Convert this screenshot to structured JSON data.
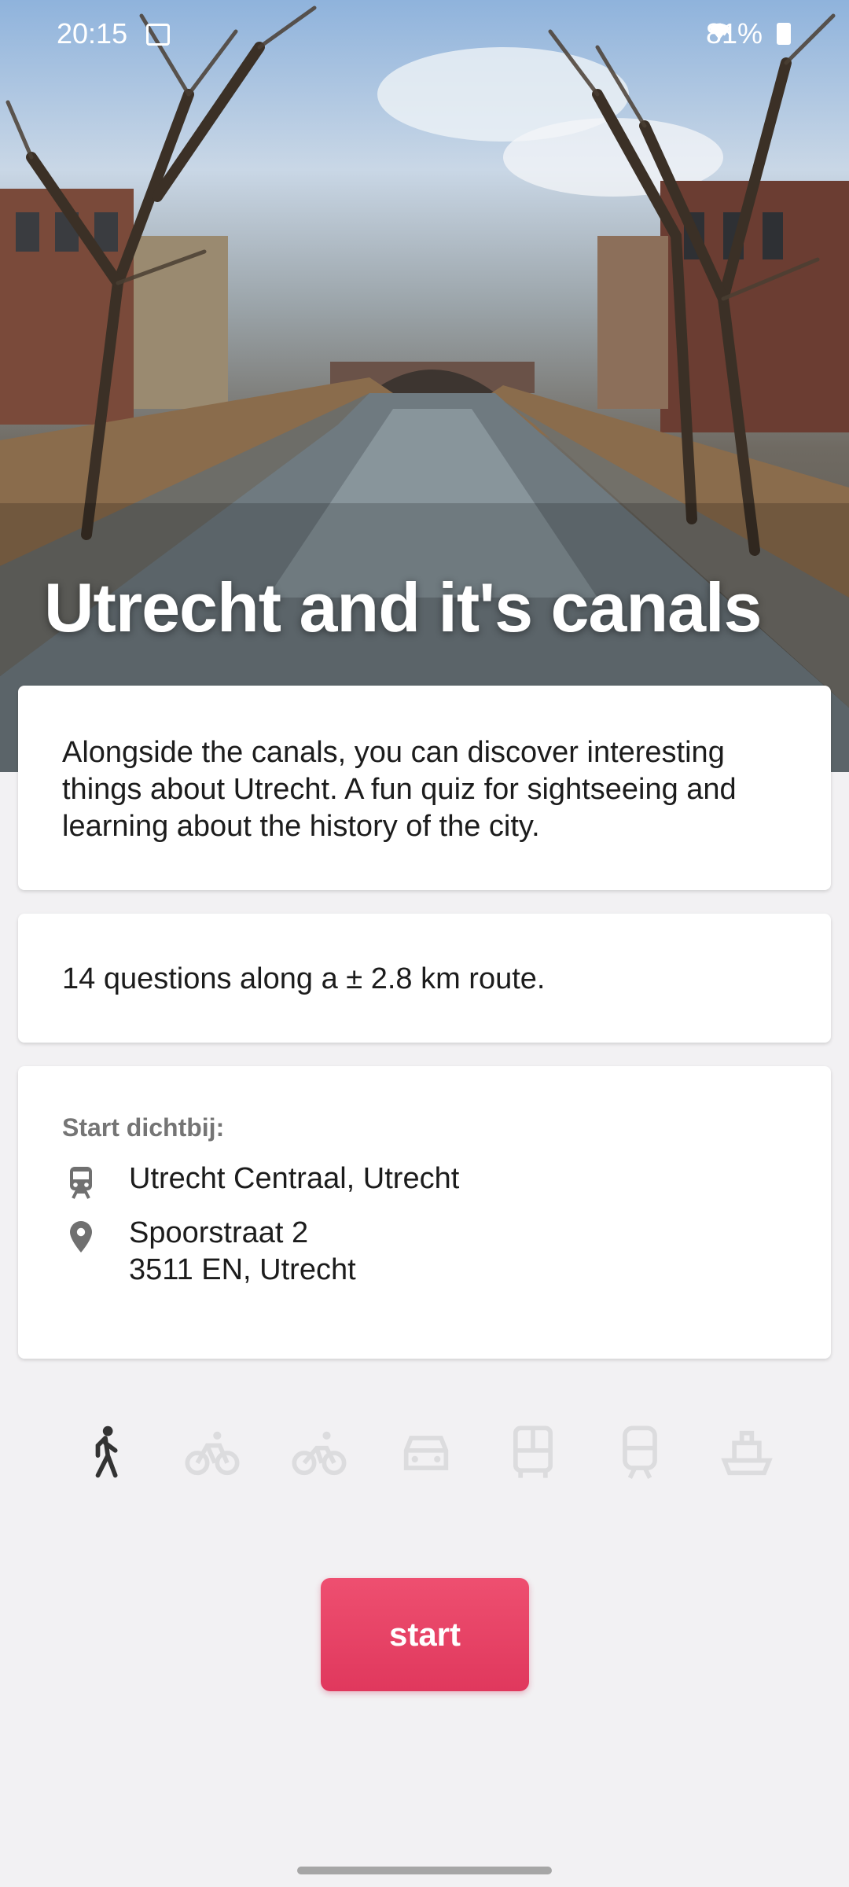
{
  "status_bar": {
    "time": "20:15",
    "battery": "81%",
    "icons": [
      "image-icon",
      "mute-icon",
      "wifi-icon",
      "battery-icon"
    ]
  },
  "hero": {
    "title": "Utrecht and it's canals"
  },
  "description": {
    "text": "Alongside the canals, you can discover interesting things about Utrecht. A fun quiz for sightseeing and learning about the history of the city."
  },
  "route": {
    "text": "14 questions along a ± 2.8 km route."
  },
  "start_location": {
    "label": "Start dichtbij:",
    "station": "Utrecht Centraal, Utrecht",
    "address_line1": "Spoorstraat 2",
    "address_line2": "3511 EN, Utrecht"
  },
  "transport_modes": [
    {
      "icon": "walk-icon",
      "active": true
    },
    {
      "icon": "bicycle-icon",
      "active": false
    },
    {
      "icon": "e-bike-icon",
      "active": false
    },
    {
      "icon": "car-icon",
      "active": false
    },
    {
      "icon": "bus-icon",
      "active": false
    },
    {
      "icon": "train-icon",
      "active": false
    },
    {
      "icon": "ferry-icon",
      "active": false
    }
  ],
  "actions": {
    "start_label": "start"
  },
  "colors": {
    "accent": "#e8436a",
    "background": "#f2f1f3",
    "inactive_icon": "#dcdcde",
    "active_icon": "#333333"
  }
}
